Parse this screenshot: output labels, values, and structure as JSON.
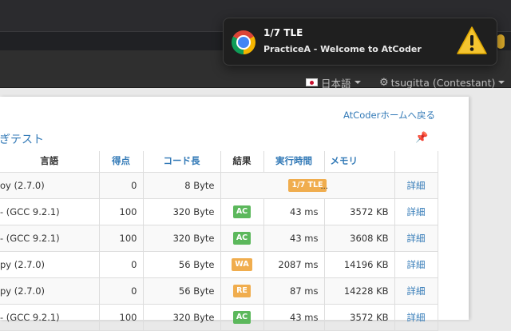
{
  "notification": {
    "title": "1/7 TLE",
    "body": "PracticeA - Welcome to AtCoder",
    "icon": "chrome-logo-icon",
    "warning_icon": "warning-icon"
  },
  "navbar": {
    "language": "日本語",
    "user": "tsugitta (Contestant)"
  },
  "page": {
    "home_link": "AtCoderホームへ戻る",
    "section_title": "ぎテスト",
    "pin_icon": "pin-icon"
  },
  "table": {
    "headers": [
      "言語",
      "得点",
      "コード長",
      "結果",
      "実行時間",
      "メモリ",
      ""
    ],
    "rows": [
      {
        "lang": "oy (2.7.0)",
        "score": "0",
        "code": "8 Byte",
        "status": "1/7 TLE",
        "status_type": "tle",
        "extra": "...",
        "time": "",
        "mem": "",
        "detail": "詳細"
      },
      {
        "lang": "- (GCC 9.2.1)",
        "score": "100",
        "code": "320 Byte",
        "status": "AC",
        "status_type": "ac",
        "extra": "",
        "time": "43 ms",
        "mem": "3572 KB",
        "detail": "詳細"
      },
      {
        "lang": "- (GCC 9.2.1)",
        "score": "100",
        "code": "320 Byte",
        "status": "AC",
        "status_type": "ac",
        "extra": "",
        "time": "43 ms",
        "mem": "3608 KB",
        "detail": "詳細"
      },
      {
        "lang": "py (2.7.0)",
        "score": "0",
        "code": "56 Byte",
        "status": "WA",
        "status_type": "wa",
        "extra": "",
        "time": "2087 ms",
        "mem": "14196 KB",
        "detail": "詳細"
      },
      {
        "lang": "py (2.7.0)",
        "score": "0",
        "code": "56 Byte",
        "status": "RE",
        "status_type": "re",
        "extra": "",
        "time": "87 ms",
        "mem": "14228 KB",
        "detail": "詳細"
      },
      {
        "lang": "- (GCC 9.2.1)",
        "score": "100",
        "code": "320 Byte",
        "status": "AC",
        "status_type": "ac",
        "extra": "",
        "time": "43 ms",
        "mem": "3572 KB",
        "detail": "詳細"
      }
    ]
  },
  "colors": {
    "link": "#337ab7",
    "ac": "#5cb85c",
    "warning": "#f0ad4e"
  }
}
